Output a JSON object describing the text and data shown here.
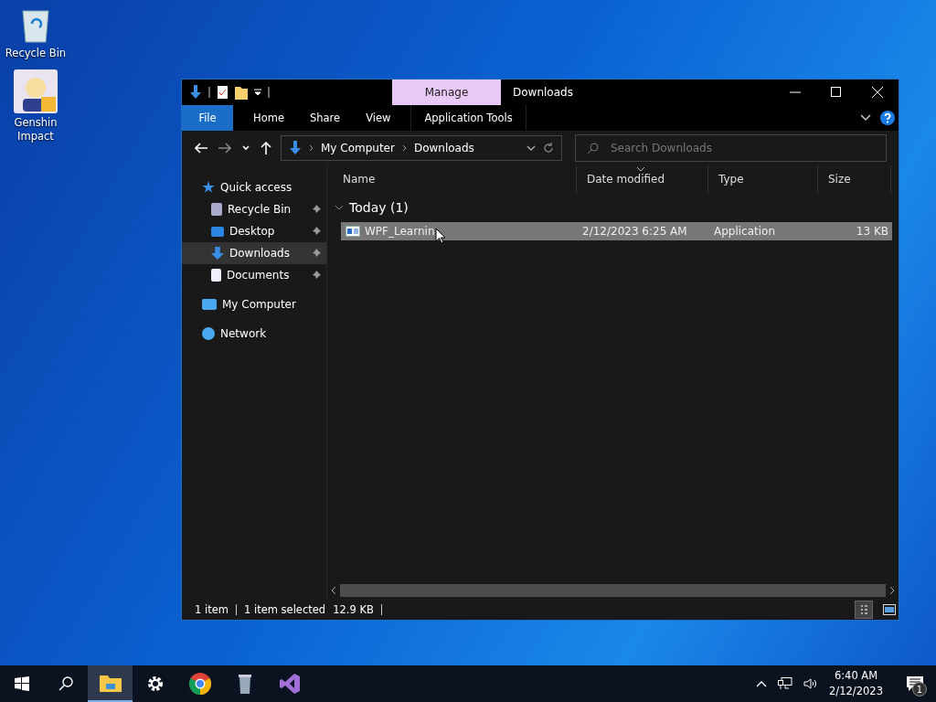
{
  "desktop_icons": [
    {
      "kind": "recycle",
      "label": "Recycle Bin"
    },
    {
      "kind": "app",
      "label": "Genshin Impact"
    }
  ],
  "window": {
    "title": "Downloads",
    "contextual_tab": "Manage",
    "ribbon_tabs": [
      {
        "label": "File",
        "kind": "file"
      },
      {
        "label": "Home",
        "kind": "plain"
      },
      {
        "label": "Share",
        "kind": "plain"
      },
      {
        "label": "View",
        "kind": "plain"
      },
      {
        "label": "Application Tools",
        "kind": "contextual"
      }
    ],
    "address": [
      "My Computer",
      "Downloads"
    ],
    "search": {
      "placeholder": "Search Downloads"
    },
    "nav_pane": [
      {
        "label": "Quick access",
        "kind": "star",
        "selected": false,
        "children": [
          {
            "label": "Recycle Bin",
            "kind": "recycle",
            "selected": false,
            "pinned": true
          },
          {
            "label": "Desktop",
            "kind": "desktop",
            "selected": false,
            "pinned": true
          },
          {
            "label": "Downloads",
            "kind": "download",
            "selected": true,
            "pinned": true
          },
          {
            "label": "Documents",
            "kind": "document",
            "selected": false,
            "pinned": true
          }
        ]
      },
      {
        "label": "My Computer",
        "kind": "computer",
        "selected": false
      },
      {
        "label": "Network",
        "kind": "network",
        "selected": false
      }
    ],
    "columns": [
      {
        "label": "Name",
        "sorted": false
      },
      {
        "label": "Date modified",
        "sorted": true
      },
      {
        "label": "Type",
        "sorted": false
      },
      {
        "label": "Size",
        "sorted": false
      }
    ],
    "groups": [
      {
        "label": "Today (1)",
        "expanded": true,
        "files": [
          {
            "name": "WPF_Learnin",
            "date": "2/12/2023 6:25 AM",
            "type": "Application",
            "size": "13 KB",
            "selected": true
          }
        ]
      }
    ],
    "status_bar": [
      "1 item",
      "1 item selected",
      "12.9 KB"
    ],
    "views": [
      {
        "kind": "details",
        "selected": true
      },
      {
        "kind": "large",
        "selected": false
      }
    ]
  },
  "taskbar": {
    "items": [
      {
        "kind": "explorer",
        "active": true
      },
      {
        "kind": "settings",
        "active": false
      },
      {
        "kind": "browser",
        "active": false
      },
      {
        "kind": "bin",
        "active": false
      },
      {
        "kind": "studio",
        "active": false
      }
    ],
    "time": "6:40 AM",
    "date": "2/12/2023",
    "notifications": "1"
  }
}
